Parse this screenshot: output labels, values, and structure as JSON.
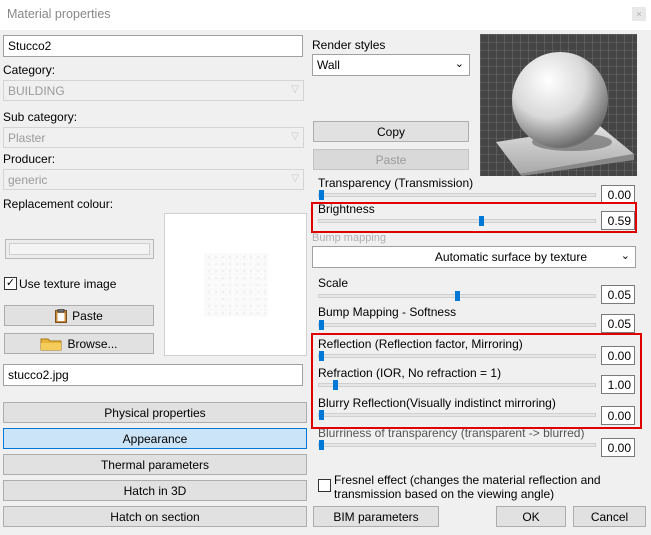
{
  "window": {
    "title": "Material properties",
    "close_glyph": "×"
  },
  "left": {
    "material_name": "Stucco2",
    "category_label": "Category:",
    "category_value": "BUILDING",
    "subcategory_label": "Sub category:",
    "subcategory_value": "Plaster",
    "producer_label": "Producer:",
    "producer_value": "generic",
    "replacement_label": "Replacement colour:",
    "use_texture_label": "Use texture image",
    "use_texture_checked": "✓",
    "paste_label": "Paste",
    "browse_label": "Browse...",
    "texture_file": "stucco2.jpg",
    "nav": {
      "physical": "Physical properties",
      "appearance": "Appearance",
      "thermal": "Thermal parameters",
      "hatch3d": "Hatch in 3D",
      "hatch_section": "Hatch on section"
    }
  },
  "right": {
    "render_styles_label": "Render styles",
    "render_style_value": "Wall",
    "copy_label": "Copy",
    "paste_label": "Paste",
    "bump_header": "Bump mapping",
    "bump_mode_value": "Automatic surface by texture",
    "fresnel_label_line1": "Fresnel effect (changes the material reflection and",
    "fresnel_label_line2": "transmission based on the viewing angle)",
    "bim_label": "BIM parameters",
    "ok_label": "OK",
    "cancel_label": "Cancel",
    "sliders": {
      "transparency": {
        "label": "Transparency (Transmission)",
        "value": "0.00",
        "fraction": 0.0
      },
      "brightness": {
        "label": "Brightness",
        "value": "0.59",
        "fraction": 0.59
      },
      "scale": {
        "label": "Scale",
        "value": "0.05",
        "fraction": 0.5
      },
      "bump_softness": {
        "label": "Bump Mapping - Softness",
        "value": "0.05",
        "fraction": 0.0
      },
      "reflection": {
        "label": "Reflection (Reflection factor, Mirroring)",
        "value": "0.00",
        "fraction": 0.0
      },
      "refraction": {
        "label": "Refraction (IOR, No refraction = 1)",
        "value": "1.00",
        "fraction": 0.05
      },
      "blurry_reflection": {
        "label": "Blurry Reflection(Visually indistinct mirroring)",
        "value": "0.00",
        "fraction": 0.0
      },
      "blurriness": {
        "label": "Blurriness of transparency (transparent -> blurred)",
        "value": "0.00",
        "fraction": 0.0
      }
    }
  },
  "colors": {
    "accent": "#0078d7",
    "highlight": "#e00000"
  }
}
